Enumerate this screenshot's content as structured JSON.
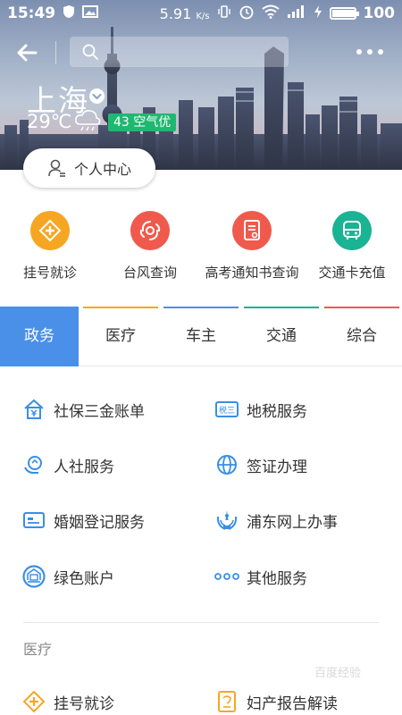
{
  "status_bar": {
    "time": "15:49",
    "network_speed": "5.91",
    "speed_unit": "K/s",
    "battery": "100",
    "battery_level": 1.0
  },
  "header": {
    "search": {
      "placeholder": "",
      "value": ""
    },
    "city": "上海",
    "temperature": "29℃",
    "weather_icon": "cloud-rain-icon",
    "aqi_label": "43 空气优",
    "personal_center": "个人中心"
  },
  "quick_services": [
    {
      "label": "挂号就诊",
      "icon": "plus-cross-icon",
      "color": "#f6a623"
    },
    {
      "label": "台风查询",
      "icon": "typhoon-icon",
      "color": "#ef5a4c"
    },
    {
      "label": "高考通知书查询",
      "icon": "document-icon",
      "color": "#ef5a4c"
    },
    {
      "label": "交通卡充值",
      "icon": "bus-icon",
      "color": "#1ab394"
    }
  ],
  "tabs": [
    {
      "label": "政务",
      "active": true,
      "accent": "#4a90e8"
    },
    {
      "label": "医疗",
      "active": false,
      "accent": "#f6a623"
    },
    {
      "label": "车主",
      "active": false,
      "accent": "#4a90e8"
    },
    {
      "label": "交通",
      "active": false,
      "accent": "#1ab394"
    },
    {
      "label": "综合",
      "active": false,
      "accent": "#ef5a4c"
    }
  ],
  "gov_services": [
    {
      "label": "社保三金账单",
      "icon": "house-yuan-icon"
    },
    {
      "label": "地税服务",
      "icon": "tax-icon"
    },
    {
      "label": "人社服务",
      "icon": "hand-service-icon"
    },
    {
      "label": "签证办理",
      "icon": "globe-icon"
    },
    {
      "label": "婚姻登记服务",
      "icon": "id-card-icon"
    },
    {
      "label": "浦东网上办事",
      "icon": "pudong-emblem-icon"
    },
    {
      "label": "绿色账户",
      "icon": "green-account-icon"
    },
    {
      "label": "其他服务",
      "icon": "more-dots-icon"
    }
  ],
  "medical_section": {
    "title": "医疗",
    "items": [
      {
        "label": "挂号就诊",
        "icon": "plus-cross-icon"
      },
      {
        "label": "妇产报告解读",
        "icon": "report-icon"
      }
    ]
  },
  "colors": {
    "primary_blue": "#4a90e8",
    "service_icon_blue": "#3a8ee6",
    "aqi_green": "#1fb871"
  },
  "watermark": "百度经验"
}
